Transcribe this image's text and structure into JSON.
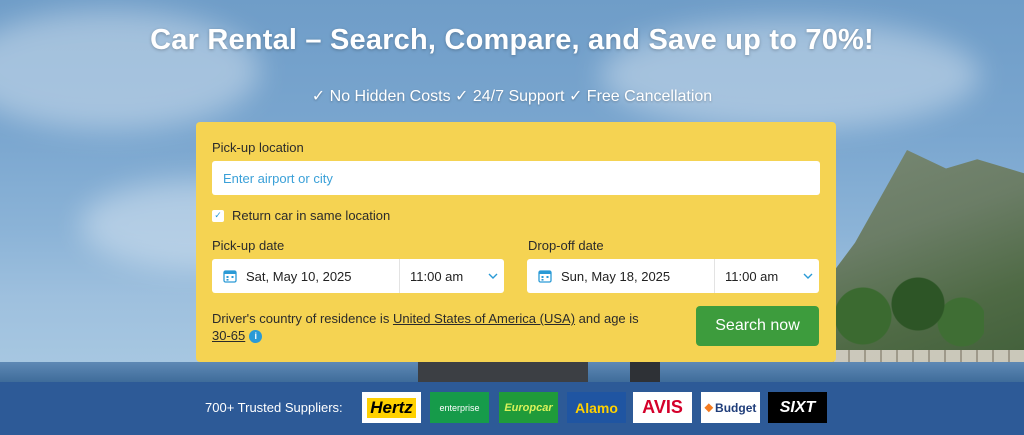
{
  "hero": {
    "title": "Car Rental – Search, Compare, and Save up to 70%!",
    "subtitle": "✓ No Hidden Costs ✓ 24/7 Support ✓ Free Cancellation"
  },
  "form": {
    "pickup_location_label": "Pick-up location",
    "pickup_location_placeholder": "Enter airport or city",
    "return_same_location_label": "Return car in same location",
    "return_same_location_checked": true,
    "pickup_date_label": "Pick-up date",
    "pickup_date": "Sat, May 10, 2025",
    "pickup_time": "11:00 am",
    "dropoff_date_label": "Drop-off date",
    "dropoff_date": "Sun, May 18, 2025",
    "dropoff_time": "11:00 am",
    "driver_text_prefix": "Driver's country of residence is",
    "driver_country": "United States of America (USA)",
    "driver_text_mid": "and age is",
    "driver_age": "30-65",
    "search_button": "Search now"
  },
  "suppliers": {
    "label": "700+ Trusted Suppliers:",
    "logos": [
      "Hertz",
      "enterprise",
      "Europcar",
      "Alamo",
      "AVIS",
      "Budget",
      "SIXT"
    ]
  },
  "colors": {
    "card_bg": "#f5d352",
    "search_button_bg": "#3d9c3d",
    "suppliers_bar_bg": "#2d5a97",
    "accent_blue": "#2a9ad6"
  },
  "icons": {
    "checkbox": "check-icon",
    "date": "calendar-icon",
    "time_dropdown": "chevron-down-icon",
    "info": "info-icon"
  }
}
